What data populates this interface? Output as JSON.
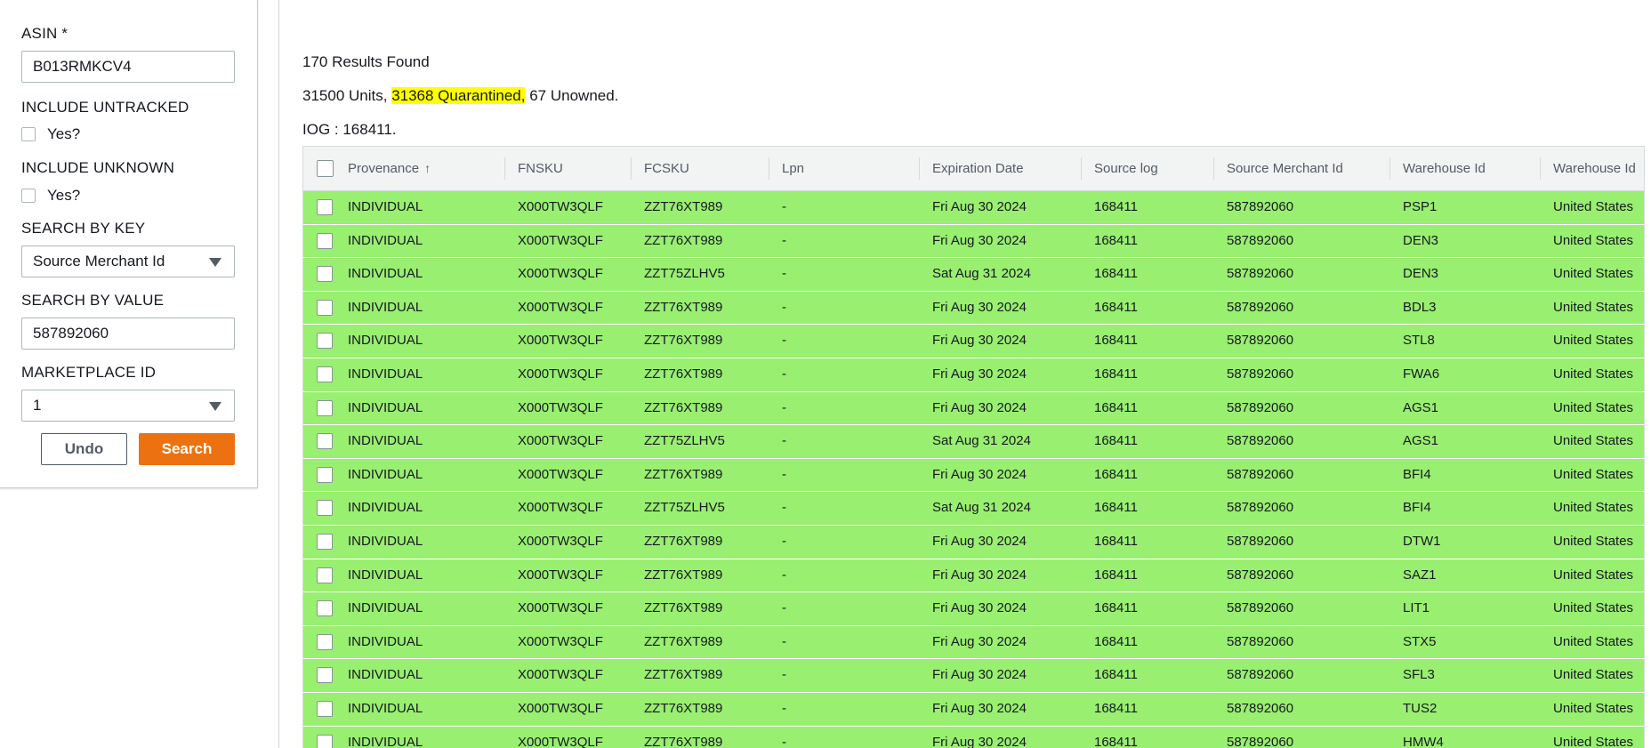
{
  "filters": {
    "asin_label": "ASIN *",
    "asin_value": "B013RMKCV4",
    "include_untracked_label": "INCLUDE UNTRACKED",
    "include_untracked_option": "Yes?",
    "include_unknown_label": "INCLUDE UNKNOWN",
    "include_unknown_option": "Yes?",
    "search_by_key_label": "SEARCH BY KEY",
    "search_by_key_value": "Source Merchant Id",
    "search_by_value_label": "SEARCH BY VALUE",
    "search_by_value_value": "587892060",
    "marketplace_label": "MARKETPLACE ID",
    "marketplace_value": "1",
    "undo_label": "Undo",
    "search_label": "Search"
  },
  "summary": {
    "results_found": "170 Results Found",
    "units": "31500 Units,",
    "quarantined": "31368 Quarantined,",
    "unowned": "67 Unowned.",
    "iog": "IOG : 168411."
  },
  "colors": {
    "row_background": "#99ef70",
    "highlight": "#ffff00",
    "search_button": "#ec7211"
  },
  "grid": {
    "sort_icon": "arrow-up-icon",
    "columns": [
      "Provenance",
      "FNSKU",
      "FCSKU",
      "Lpn",
      "Expiration Date",
      "Source log",
      "Source Merchant Id",
      "Warehouse Id",
      "Warehouse Id"
    ],
    "rows": [
      [
        "INDIVIDUAL",
        "X000TW3QLF",
        "ZZT76XT989",
        "-",
        "Fri Aug 30 2024",
        "168411",
        "587892060",
        "PSP1",
        "United States"
      ],
      [
        "INDIVIDUAL",
        "X000TW3QLF",
        "ZZT76XT989",
        "-",
        "Fri Aug 30 2024",
        "168411",
        "587892060",
        "DEN3",
        "United States"
      ],
      [
        "INDIVIDUAL",
        "X000TW3QLF",
        "ZZT75ZLHV5",
        "-",
        "Sat Aug 31 2024",
        "168411",
        "587892060",
        "DEN3",
        "United States"
      ],
      [
        "INDIVIDUAL",
        "X000TW3QLF",
        "ZZT76XT989",
        "-",
        "Fri Aug 30 2024",
        "168411",
        "587892060",
        "BDL3",
        "United States"
      ],
      [
        "INDIVIDUAL",
        "X000TW3QLF",
        "ZZT76XT989",
        "-",
        "Fri Aug 30 2024",
        "168411",
        "587892060",
        "STL8",
        "United States"
      ],
      [
        "INDIVIDUAL",
        "X000TW3QLF",
        "ZZT76XT989",
        "-",
        "Fri Aug 30 2024",
        "168411",
        "587892060",
        "FWA6",
        "United States"
      ],
      [
        "INDIVIDUAL",
        "X000TW3QLF",
        "ZZT76XT989",
        "-",
        "Fri Aug 30 2024",
        "168411",
        "587892060",
        "AGS1",
        "United States"
      ],
      [
        "INDIVIDUAL",
        "X000TW3QLF",
        "ZZT75ZLHV5",
        "-",
        "Sat Aug 31 2024",
        "168411",
        "587892060",
        "AGS1",
        "United States"
      ],
      [
        "INDIVIDUAL",
        "X000TW3QLF",
        "ZZT76XT989",
        "-",
        "Fri Aug 30 2024",
        "168411",
        "587892060",
        "BFI4",
        "United States"
      ],
      [
        "INDIVIDUAL",
        "X000TW3QLF",
        "ZZT75ZLHV5",
        "-",
        "Sat Aug 31 2024",
        "168411",
        "587892060",
        "BFI4",
        "United States"
      ],
      [
        "INDIVIDUAL",
        "X000TW3QLF",
        "ZZT76XT989",
        "-",
        "Fri Aug 30 2024",
        "168411",
        "587892060",
        "DTW1",
        "United States"
      ],
      [
        "INDIVIDUAL",
        "X000TW3QLF",
        "ZZT76XT989",
        "-",
        "Fri Aug 30 2024",
        "168411",
        "587892060",
        "SAZ1",
        "United States"
      ],
      [
        "INDIVIDUAL",
        "X000TW3QLF",
        "ZZT76XT989",
        "-",
        "Fri Aug 30 2024",
        "168411",
        "587892060",
        "LIT1",
        "United States"
      ],
      [
        "INDIVIDUAL",
        "X000TW3QLF",
        "ZZT76XT989",
        "-",
        "Fri Aug 30 2024",
        "168411",
        "587892060",
        "STX5",
        "United States"
      ],
      [
        "INDIVIDUAL",
        "X000TW3QLF",
        "ZZT76XT989",
        "-",
        "Fri Aug 30 2024",
        "168411",
        "587892060",
        "SFL3",
        "United States"
      ],
      [
        "INDIVIDUAL",
        "X000TW3QLF",
        "ZZT76XT989",
        "-",
        "Fri Aug 30 2024",
        "168411",
        "587892060",
        "TUS2",
        "United States"
      ],
      [
        "INDIVIDUAL",
        "X000TW3QLF",
        "ZZT76XT989",
        "-",
        "Fri Aug 30 2024",
        "168411",
        "587892060",
        "HMW4",
        "United States"
      ]
    ]
  }
}
